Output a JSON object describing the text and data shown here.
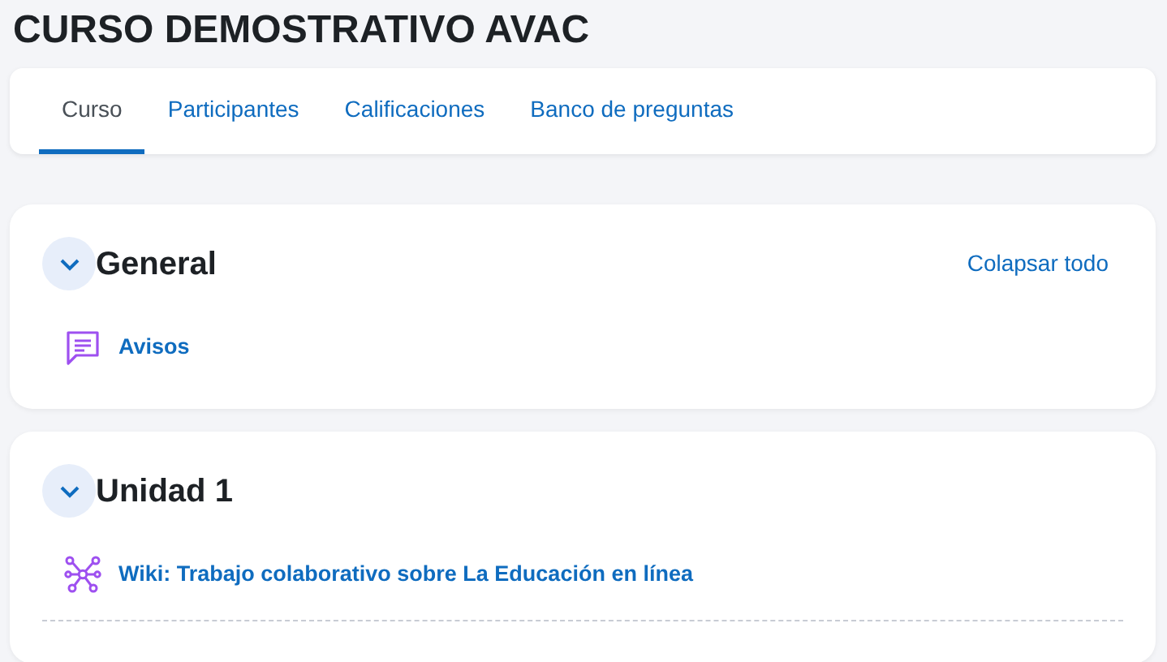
{
  "course_title": "CURSO DEMOSTRATIVO AVAC",
  "tabs": [
    {
      "label": "Curso",
      "selected": true
    },
    {
      "label": "Participantes",
      "selected": false
    },
    {
      "label": "Calificaciones",
      "selected": false
    },
    {
      "label": "Banco de preguntas",
      "selected": false
    }
  ],
  "collapse_all_link": "Colapsar todo",
  "sections": [
    {
      "title": "General",
      "expanded": true,
      "activities": [
        {
          "kind": "forum",
          "label": "Avisos"
        }
      ]
    },
    {
      "title": "Unidad 1",
      "expanded": true,
      "activities": [
        {
          "kind": "wiki",
          "label": "Wiki: Trabajo colaborativo sobre La Educación en línea"
        }
      ]
    }
  ]
}
